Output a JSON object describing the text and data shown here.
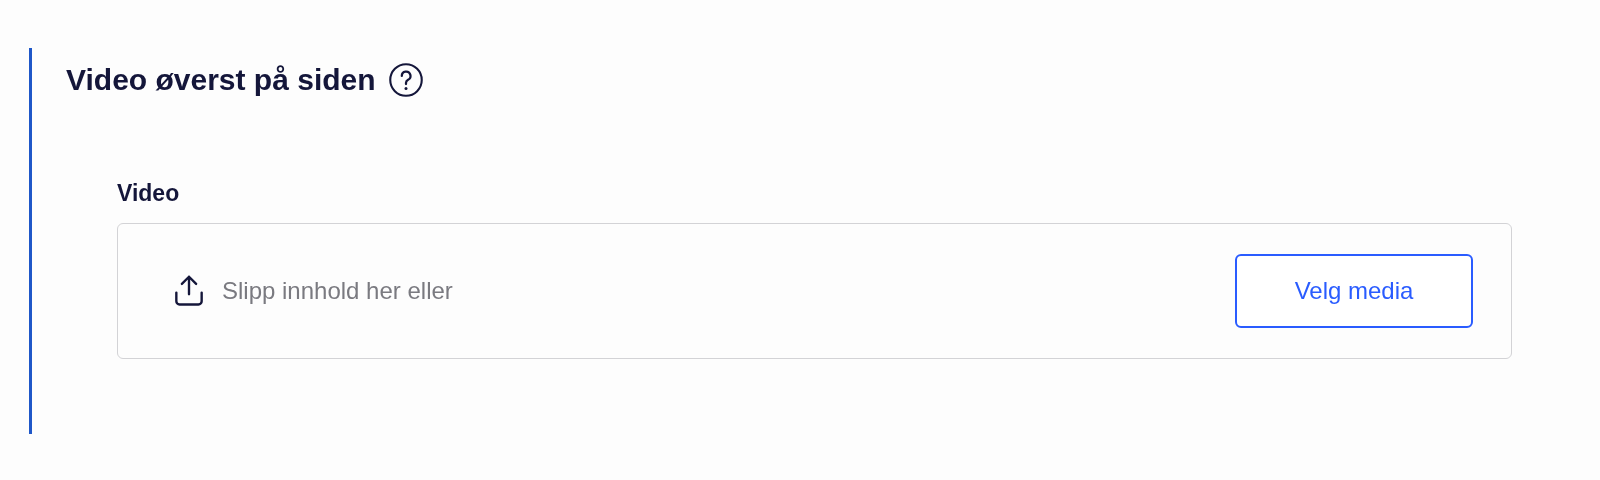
{
  "section": {
    "title": "Video øverst på siden",
    "field": {
      "label": "Video",
      "dropzone": {
        "text": "Slipp innhold her eller",
        "button": "Velg media"
      }
    }
  }
}
